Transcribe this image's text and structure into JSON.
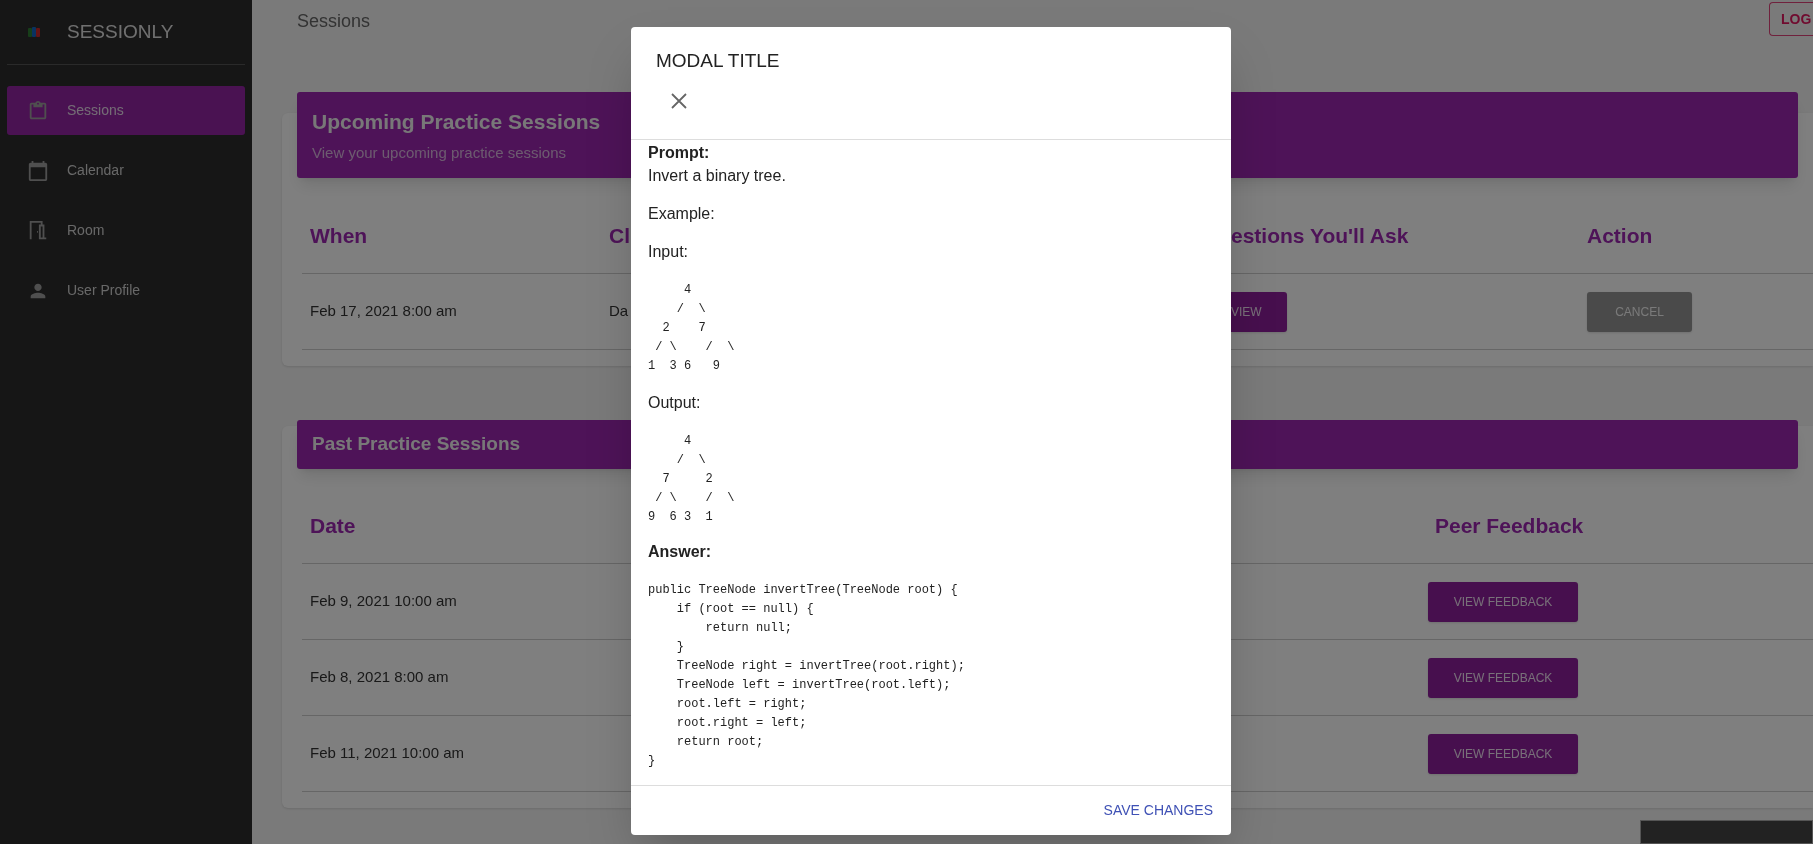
{
  "sidebar": {
    "brand": "SESSIONLY",
    "items": [
      {
        "label": "Sessions",
        "selected": true
      },
      {
        "label": "Calendar",
        "selected": false
      },
      {
        "label": "Room",
        "selected": false
      },
      {
        "label": "User Profile",
        "selected": false
      }
    ]
  },
  "header": {
    "title": "Sessions",
    "logout_button": "LOG"
  },
  "upcoming": {
    "title": "Upcoming Practice Sessions",
    "subtitle": "View your upcoming practice sessions",
    "columns": [
      "When",
      "Cl",
      "estions You'll Ask",
      "Action"
    ],
    "rows": [
      {
        "when": "Feb 17, 2021 8:00 am",
        "column_2": "Da",
        "view_button": "VIEW",
        "action_button": "CANCEL"
      }
    ]
  },
  "past": {
    "title": "Past Practice Sessions",
    "columns": [
      "Date",
      "Peer Feedback"
    ],
    "rows": [
      {
        "date": "Feb 9, 2021 10:00 am",
        "feedback_button": "VIEW FEEDBACK"
      },
      {
        "date": "Feb 8, 2021 8:00 am",
        "feedback_button": "VIEW FEEDBACK"
      },
      {
        "date": "Feb 11, 2021 10:00 am",
        "feedback_button": "VIEW FEEDBACK"
      }
    ]
  },
  "modal": {
    "title": "MODAL TITLE",
    "body": [
      {
        "kind": "label",
        "text": "Prompt:"
      },
      {
        "kind": "text",
        "text": "Invert a binary tree."
      },
      {
        "kind": "text",
        "text": "Example:"
      },
      {
        "kind": "text",
        "text": "Input:"
      },
      {
        "kind": "code",
        "lines": [
          "     4",
          "    /  \\",
          "  2    7",
          " / \\    /  \\",
          "1  3 6   9"
        ]
      },
      {
        "kind": "text",
        "text": "Output:"
      },
      {
        "kind": "code",
        "lines": [
          "     4",
          "    /  \\",
          "  7     2",
          " / \\    /  \\",
          "9  6 3  1"
        ]
      },
      {
        "kind": "label",
        "text": "Answer:"
      },
      {
        "kind": "code",
        "lines": [
          "public TreeNode invertTree(TreeNode root) {",
          "    if (root == null) {",
          "        return null;",
          "    }",
          "    TreeNode right = invertTree(root.right);",
          "    TreeNode left = invertTree(root.left);",
          "    root.left = right;",
          "    root.right = left;",
          "    return root;",
          "}"
        ]
      }
    ],
    "save_button": "SAVE CHANGES"
  }
}
